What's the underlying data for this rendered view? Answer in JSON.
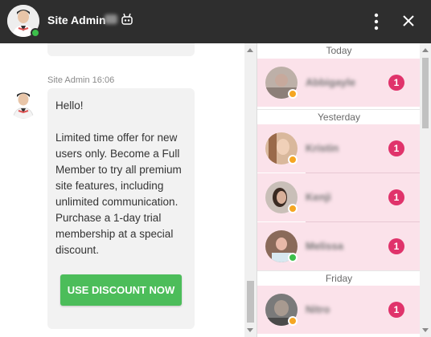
{
  "header": {
    "title": "Site Admin",
    "age": "28",
    "robot_icon": "robot-icon",
    "menu_icon": "more-vertical-icon",
    "close_icon": "close-icon",
    "online_color": "#3cbf4b",
    "background": "#2e2e2e"
  },
  "message": {
    "sender": "Site Admin",
    "time": "16:06",
    "greeting": "Hello!",
    "body": "Limited time offer for new users only. Become a Full Member to try all premium site features, including unlimited communication. Purchase a 1-day trial membership at a special discount.",
    "button_label": "USE DISCOUNT NOW",
    "button_color": "#4cbd5a"
  },
  "contacts": {
    "sections": [
      {
        "label": "Today"
      },
      {
        "label": "Yesterday"
      },
      {
        "label": "Friday"
      }
    ],
    "items": [
      {
        "name": "Abbigayle",
        "unread": "1",
        "status_color": "#f5a623"
      },
      {
        "name": "Kristin",
        "unread": "1",
        "status_color": "#f5a623"
      },
      {
        "name": "Kenji",
        "unread": "1",
        "status_color": "#f5a623"
      },
      {
        "name": "Melissa",
        "unread": "1",
        "status_color": "#3cbf4b"
      },
      {
        "name": "Nitro",
        "unread": "1",
        "status_color": "#f5a623"
      }
    ],
    "highlight_color": "#fbe2ea",
    "badge_color": "#e0336b"
  }
}
